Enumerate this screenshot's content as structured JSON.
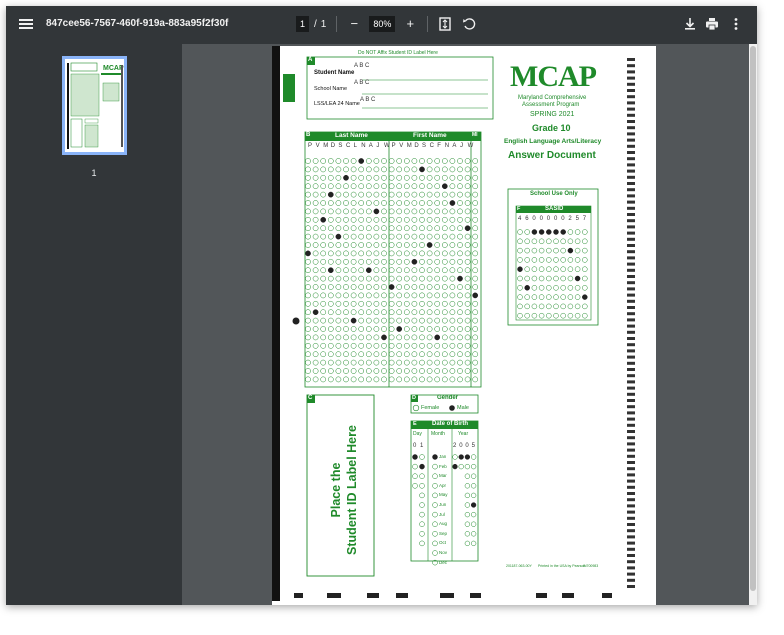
{
  "toolbar": {
    "title": "847cee56-7567-460f-919a-883a95f2f30f",
    "page_current": "1",
    "page_separator": "/",
    "page_total": "1",
    "zoom": "80%",
    "icons": [
      "menu-icon",
      "zoom-out-icon",
      "zoom-in-icon",
      "fit-page-icon",
      "rotate-icon",
      "download-icon",
      "print-icon",
      "more-vert-icon"
    ]
  },
  "sidebar": {
    "thumb_label": "1"
  },
  "document": {
    "top_notice": "Do NOT Affix Student ID Label Here",
    "section_a": "A",
    "student_name_label": "Student Name",
    "student_name_value": "A  B  C",
    "school_name_label": "School Name",
    "school_name_value": "A  B  C",
    "lss_label": "LSS/LEA 24 Name",
    "lss_value": "A  B  C",
    "logo": "MCAP",
    "program_line1": "Maryland Comprehensive",
    "program_line2": "Assessment Program",
    "season": "SPRING 2021",
    "grade": "Grade 10",
    "subject": "English Language Arts/Literacy",
    "doc_title": "Answer Document",
    "section_b": "B",
    "last_name_header": "Last Name",
    "first_name_header": "First Name",
    "mi_header": "MI",
    "last_name_letters": [
      "P",
      "V",
      "M",
      "D",
      "S",
      "C",
      "L",
      "N",
      "A",
      "J",
      "W"
    ],
    "first_name_letters": [
      "P",
      "V",
      "M",
      "D",
      "S",
      "C",
      "F",
      "N",
      "A",
      "J",
      "W"
    ],
    "school_use_only": "School Use Only",
    "section_f": "F",
    "sasid_header": "SASID",
    "sasid_digits": [
      "4",
      "6",
      "0",
      "0",
      "0",
      "0",
      "0",
      "2",
      "5",
      "7"
    ],
    "section_c": "C",
    "place_label_line1": "Place the",
    "place_label_line2": "Student ID Label Here",
    "section_d": "D",
    "gender_header": "Gender",
    "gender_female": "Female",
    "gender_male": "Male",
    "section_e": "E",
    "dob_header": "Date of Birth",
    "dob_day": "Day",
    "dob_month": "Month",
    "dob_year": "Year",
    "dob_day_digits": [
      "0",
      "1"
    ],
    "dob_year_digits": [
      "2",
      "0",
      "0",
      "5"
    ],
    "months": [
      "Jan",
      "Feb",
      "Mar",
      "Apr",
      "May",
      "Jun",
      "Jul",
      "Aug",
      "Sep",
      "Oct",
      "Nov",
      "Dec"
    ],
    "footer_code": "201187-063-00Y",
    "footer_printed": "Printed in the USA by Pearson",
    "footer_id": "IN700983"
  },
  "colors": {
    "accent_green": "#1f8a2a",
    "toolbar_bg": "#323639",
    "viewer_bg": "#525659",
    "thumb_border": "#8ab4f8"
  }
}
